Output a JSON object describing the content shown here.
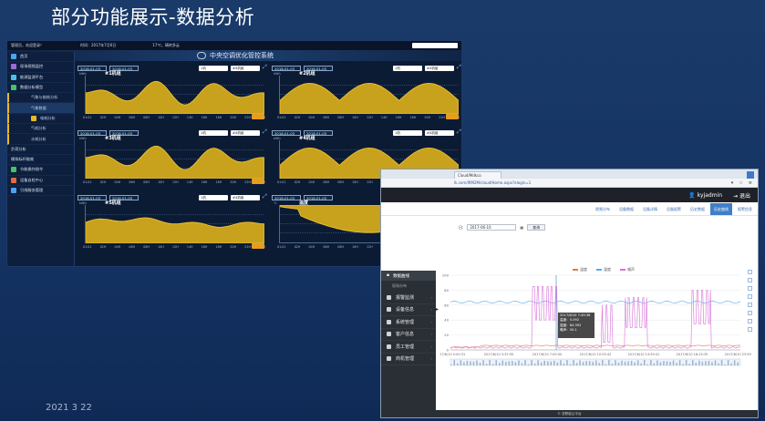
{
  "slide": {
    "title": "部分功能展示-数据分析",
    "date": "2021  3  22"
  },
  "s1": {
    "topbar": {
      "user": "管理员，欢迎登录！",
      "date": "时间：2017年7月6日",
      "weather": "17℃，晴转多云"
    },
    "header": {
      "title": "中央空调优化管控系统"
    },
    "sidebar": [
      {
        "label": "首页",
        "icon": "home-icon",
        "color": "#4aa3f0",
        "sub": false
      },
      {
        "label": "现场视频监控",
        "icon": "video-icon",
        "color": "#9b6bd8",
        "sub": false
      },
      {
        "label": "能源监测平台",
        "icon": "energy-icon",
        "color": "#4ac0f0",
        "sub": false
      },
      {
        "label": "数据分析模型",
        "icon": "chart-icon",
        "color": "#45c26b",
        "sub": false
      },
      {
        "label": "气象与能耗分析",
        "icon": "",
        "color": "",
        "sub": true
      },
      {
        "label": "气象数据",
        "icon": "",
        "color": "",
        "sub": true,
        "active": true
      },
      {
        "label": "电耗分析",
        "icon": "star-icon",
        "color": "#e8b829",
        "sub": true
      },
      {
        "label": "气耗分析",
        "icon": "",
        "color": "",
        "sub": true
      },
      {
        "label": "水耗分析",
        "icon": "",
        "color": "",
        "sub": true
      },
      {
        "label": "负荷分析",
        "icon": "",
        "color": "",
        "sub": false
      },
      {
        "label": "模拟标杆能耗",
        "icon": "",
        "color": "",
        "sub": false
      },
      {
        "label": "节能操作指令",
        "icon": "cycle-icon",
        "color": "#45c26b",
        "sub": false
      },
      {
        "label": "设备自检中心",
        "icon": "settings-icon",
        "color": "#e36b3a",
        "sub": false
      },
      {
        "label": "引线服务管理",
        "icon": "grid-icon",
        "color": "#4aa3f0",
        "sub": false
      }
    ],
    "panels": [
      {
        "title": "#1机组",
        "date1": "2018-01-03",
        "date2": "2018-01-03",
        "select1": "1机",
        "select2": "#4机组",
        "unit": "kWh",
        "kind": "wave"
      },
      {
        "title": "#2机组",
        "date1": "2018-01-03",
        "date2": "2018-01-03",
        "select1": "1机",
        "select2": "#4机组",
        "unit": "kWh",
        "kind": "wave"
      },
      {
        "title": "#3机组",
        "date1": "2018-01-03",
        "date2": "2018-01-03",
        "select1": "1机",
        "select2": "#4机组",
        "unit": "kWh",
        "kind": "wave"
      },
      {
        "title": "#4机组",
        "date1": "2018-01-03",
        "date2": "2018-01-03",
        "select1": "1机",
        "select2": "#4机组",
        "unit": "kWh",
        "kind": "wave"
      },
      {
        "title": "#5机组",
        "date1": "2018-01-03",
        "date2": "2018-01-03",
        "select1": "1机",
        "select2": "#4机组",
        "unit": "kWh",
        "kind": "flat"
      },
      {
        "title": "温度",
        "date1": "2018-01-03",
        "date2": "2018-01-03",
        "select1": "温度",
        "select2": "",
        "unit": "℃",
        "kind": "dip"
      }
    ],
    "xticks": [
      "01:01",
      "02H",
      "04H",
      "06H",
      "08H",
      "10H",
      "12H",
      "14H",
      "16H",
      "18H",
      "20H",
      "22H",
      "24H"
    ]
  },
  "s2": {
    "tab": "Cloud/Mdkco",
    "url": "lk.com/IRM2M/cloud/Home.aspx?elogin=1",
    "user": "kyjadmin",
    "logout": "退出",
    "nav": [
      "视频分布",
      "设备数据",
      "设备详情",
      "设备报警",
      "历史数据",
      "历史曲线",
      "报警信息"
    ],
    "nav_active": 5,
    "query": {
      "date": "2017-06-10",
      "btn": "查询"
    },
    "legend": [
      {
        "name": "温度",
        "color": "#e8734a"
      },
      {
        "name": "湿度",
        "color": "#5aa9e6"
      },
      {
        "name": "噪声",
        "color": "#d96fd8"
      }
    ],
    "left_top": "数据曲线",
    "left_sub": "现场分布",
    "menu": [
      "报警监测",
      "设备信息",
      "系统管理",
      "客户信息",
      "员工管理",
      "商机管理"
    ],
    "tooltip": [
      "2017/6/10 7:49:38",
      "温度：5.092",
      "湿度：64.392",
      "噪声：50.1"
    ],
    "xticks": [
      "2017/6/10 0:00:31",
      "2017/6/10 3:32:55",
      "2017/6/10 7:00:00",
      "2017/6/10 10:55:42",
      "2017/6/10 14:59:41",
      "2017/6/10 18:15:35",
      "2017/6/10 23:59:47"
    ],
    "yticks": [
      "100",
      "80",
      "60",
      "40",
      "20",
      "0"
    ],
    "footer": "© 亚联能云平台"
  }
}
